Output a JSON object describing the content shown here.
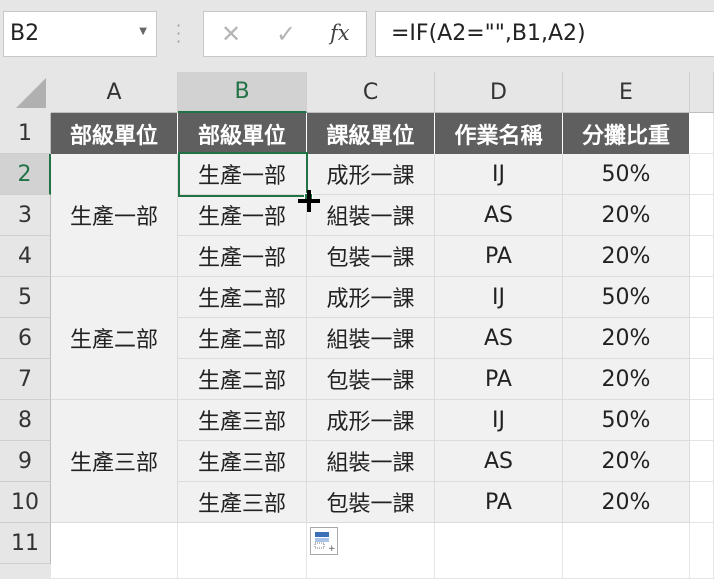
{
  "formula_bar": {
    "name_box": "B2",
    "formula": "=IF(A2=\"\",B1,A2)"
  },
  "columns": [
    "A",
    "B",
    "C",
    "D",
    "E"
  ],
  "rows": [
    "1",
    "2",
    "3",
    "4",
    "5",
    "6",
    "7",
    "8",
    "9",
    "10",
    "11"
  ],
  "header_row": [
    "部級單位",
    "部級單位",
    "課級單位",
    "作業名稱",
    "分攤比重"
  ],
  "merged_a": [
    "生產一部",
    "生產二部",
    "生產三部"
  ],
  "data_rows": [
    [
      "生產一部",
      "成形一課",
      "IJ",
      "50%"
    ],
    [
      "生產一部",
      "組裝一課",
      "AS",
      "20%"
    ],
    [
      "生產一部",
      "包裝一課",
      "PA",
      "20%"
    ],
    [
      "生產二部",
      "成形一課",
      "IJ",
      "50%"
    ],
    [
      "生產二部",
      "組裝一課",
      "AS",
      "20%"
    ],
    [
      "生產二部",
      "包裝一課",
      "PA",
      "20%"
    ],
    [
      "生產三部",
      "成形一課",
      "IJ",
      "50%"
    ],
    [
      "生產三部",
      "組裝一課",
      "AS",
      "20%"
    ],
    [
      "生產三部",
      "包裝一課",
      "PA",
      "20%"
    ]
  ],
  "colors": {
    "accent": "#217346",
    "header_fill": "#5f5f5f",
    "data_fill": "#f1f1f1"
  },
  "icons": {
    "cancel": "cancel-icon",
    "enter": "enter-icon",
    "fx": "function-icon",
    "paste_options": "paste-options-icon"
  }
}
